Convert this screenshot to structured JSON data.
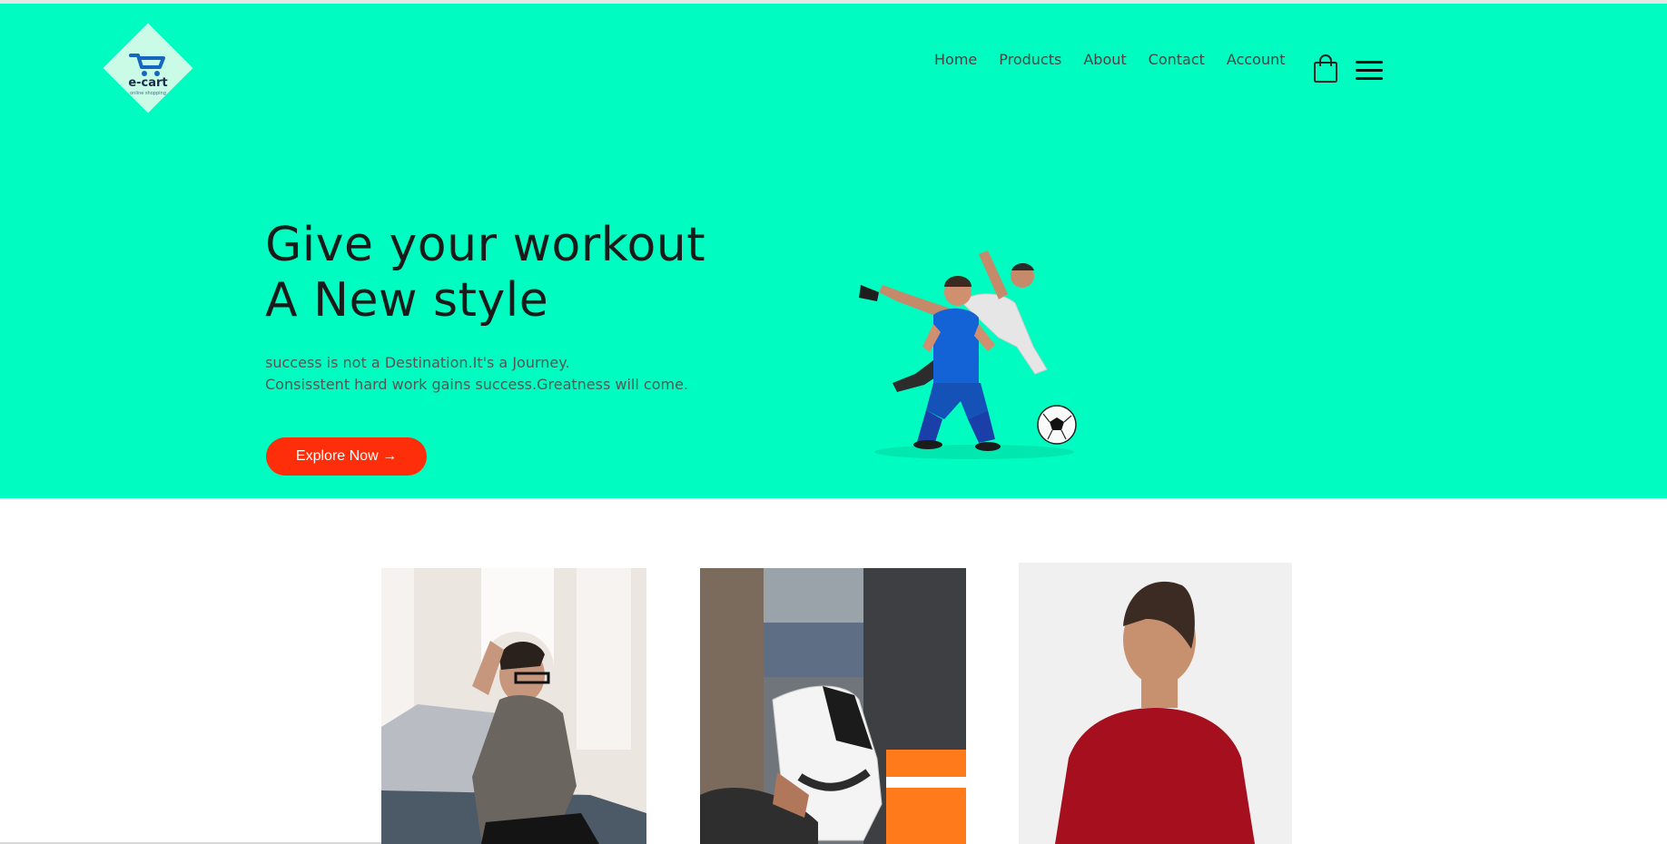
{
  "logo": {
    "brand": "e-cart",
    "tagline": "online shopping"
  },
  "nav": {
    "items": [
      "Home",
      "Products",
      "About",
      "Contact",
      "Account"
    ]
  },
  "hero": {
    "headline_line1": "Give your workout",
    "headline_line2": "A New style",
    "sub_line1": "success is not a Destination.It's a Journey.",
    "sub_line2": "Consisstent hard work gains success.Greatness will come.",
    "cta_label": "Explore Now →"
  },
  "colors": {
    "hero_bg": "#00fcc0",
    "cta": "#ff2e0a"
  },
  "icons": [
    "shopping-bag-icon",
    "hamburger-menu-icon",
    "cart-logo-icon"
  ]
}
